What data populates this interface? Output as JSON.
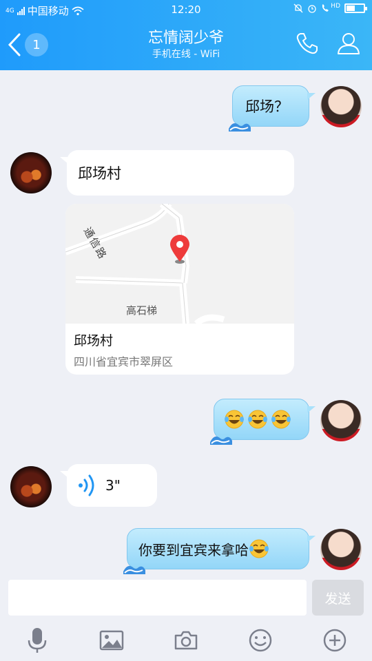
{
  "status_bar": {
    "network_type": "4G",
    "carrier": "中国移动",
    "time": "12:20",
    "hd_badge": "HD"
  },
  "header": {
    "unread_count": "1",
    "title": "忘情阔少爷",
    "subtitle": "手机在线 - WiFi",
    "icons": [
      "back-arrow-icon",
      "phone-icon",
      "profile-icon"
    ]
  },
  "messages": {
    "m1_text": "邱场？",
    "m2_text": "邱场村",
    "map": {
      "road_label": "通信路",
      "place_label": "高石梯",
      "name": "邱场村",
      "address": "四川省宜宾市翠屏区"
    },
    "m4_emoji": [
      "laughing-tears-emoji",
      "laughing-tears-emoji",
      "laughing-tears-emoji"
    ],
    "m5_duration": "3\"",
    "m6_text": "你要到宜宾来拿哈"
  },
  "input": {
    "value": "",
    "placeholder": "",
    "send_label": "发送"
  },
  "toolbar": [
    "microphone-icon",
    "image-icon",
    "camera-icon",
    "smiley-icon",
    "plus-icon"
  ],
  "colors": {
    "header_start": "#1f9bfb",
    "header_end": "#3bb6f7",
    "my_bubble": "#a9e1fb",
    "background": "#eef0f6",
    "map_pin": "#ee3b3b",
    "voice_wave": "#2196f3"
  }
}
